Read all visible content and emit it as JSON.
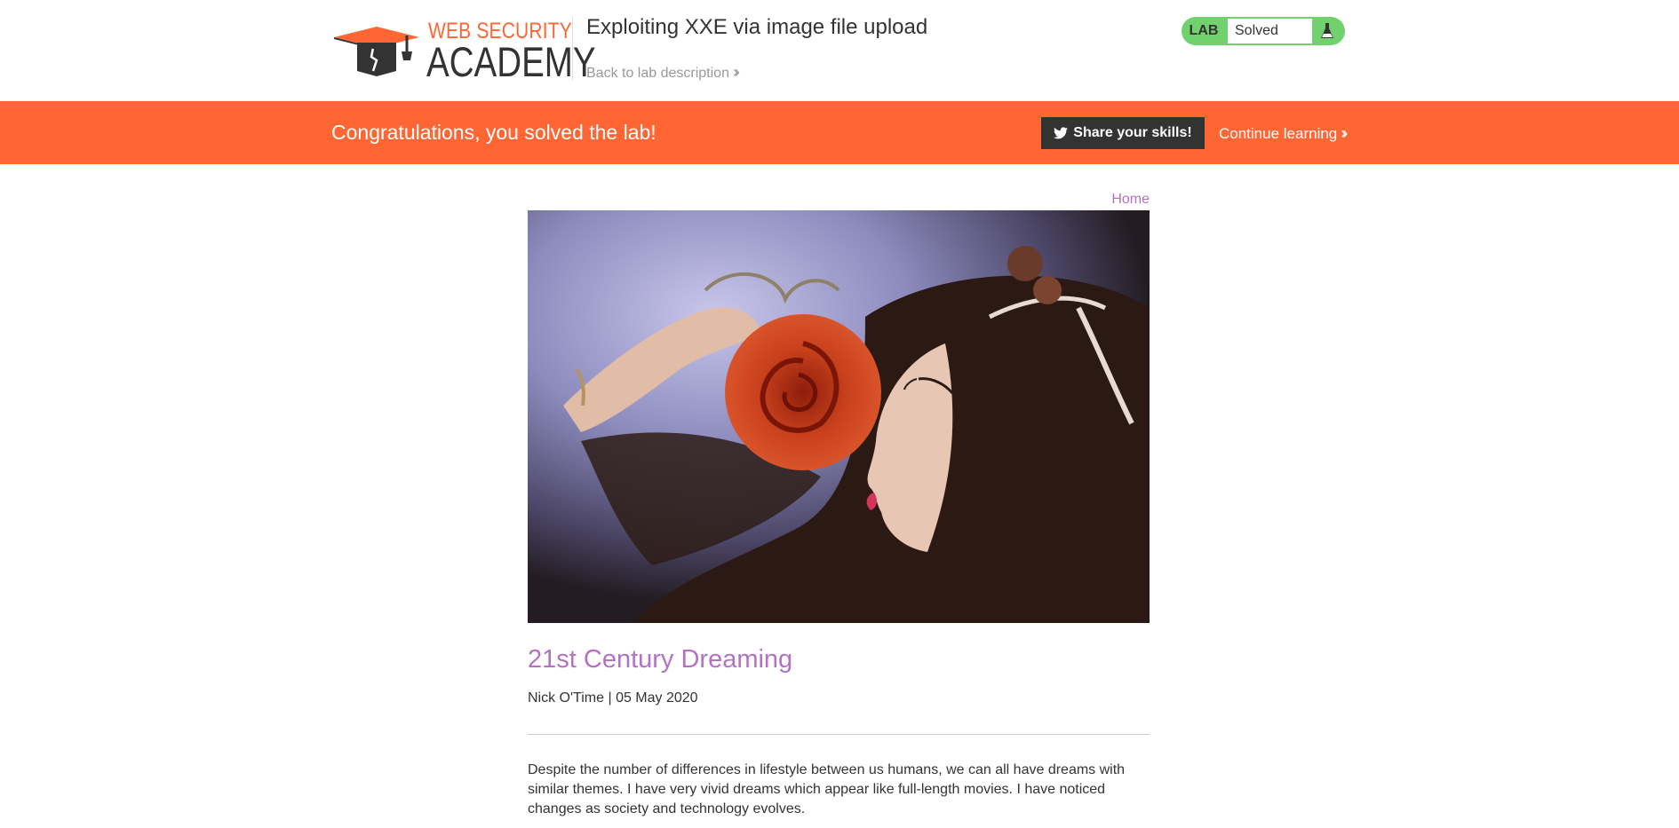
{
  "header": {
    "logo": {
      "top_text": "WEB SECURITY",
      "bottom_text": "ACADEMY",
      "icon": "graduation-cap-logo"
    },
    "lab_title": "Exploiting XXE via image file upload",
    "back_link": "Back to lab description",
    "lab_status": {
      "badge": "LAB",
      "status": "Solved",
      "icon": "flask-icon"
    }
  },
  "banner": {
    "message": "Congratulations, you solved the lab!",
    "share_button": "Share your skills!",
    "share_icon": "twitter-icon",
    "continue_link": "Continue learning"
  },
  "nav": {
    "home_link": "Home"
  },
  "post": {
    "title": "21st Century Dreaming",
    "meta": "Nick O'Time | 05 May 2020",
    "body": "Despite the number of differences in lifestyle between us humans, we can all have dreams with similar themes. I have very vivid dreams which appear like full-length movies. I have noticed changes as society and technology evolves."
  },
  "colors": {
    "brand_orange": "#ff6633",
    "link_purple": "#b472c5",
    "solved_green": "#70d16d",
    "dark": "#333333"
  }
}
